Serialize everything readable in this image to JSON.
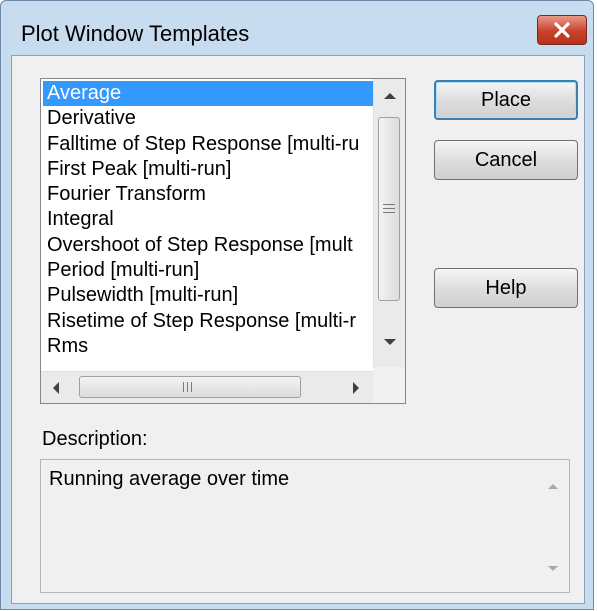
{
  "window": {
    "title": "Plot Window Templates",
    "close_icon": "close-x-icon"
  },
  "template_list": {
    "selected_index": 0,
    "items": [
      "Average",
      "Derivative",
      "Falltime of Step Response [multi-ru",
      "First Peak [multi-run]",
      "Fourier Transform",
      "Integral",
      "Overshoot of Step Response [mult",
      "Period [multi-run]",
      "Pulsewidth [multi-run]",
      "Risetime of Step Response [multi-r",
      "Rms"
    ],
    "hscroll_grip_glyph": "III"
  },
  "buttons": {
    "place": "Place",
    "cancel": "Cancel",
    "help": "Help"
  },
  "description": {
    "label": "Description:",
    "text": "Running average over time"
  },
  "colors": {
    "selection": "#3399ff",
    "frame": "#c8dcef",
    "close_button": "#c9412b"
  }
}
